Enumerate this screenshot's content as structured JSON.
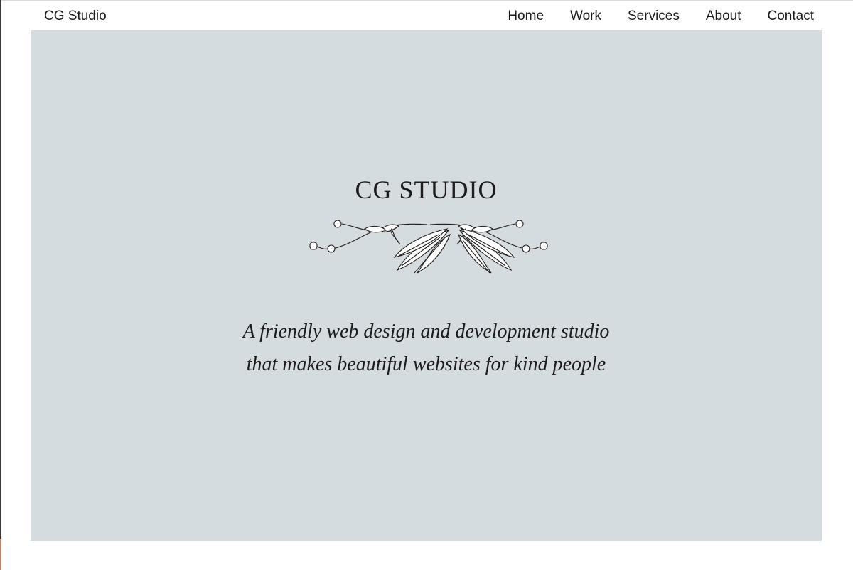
{
  "header": {
    "brand": "CG Studio",
    "nav": [
      "Home",
      "Work",
      "Services",
      "About",
      "Contact"
    ]
  },
  "hero": {
    "title": "CG STUDIO",
    "tagline_line1": "A friendly web design and development studio",
    "tagline_line2": "that makes beautiful websites for kind people",
    "ornament_icon": "floral-laurel-ornament-icon",
    "background_color": "#d5dcdf"
  }
}
